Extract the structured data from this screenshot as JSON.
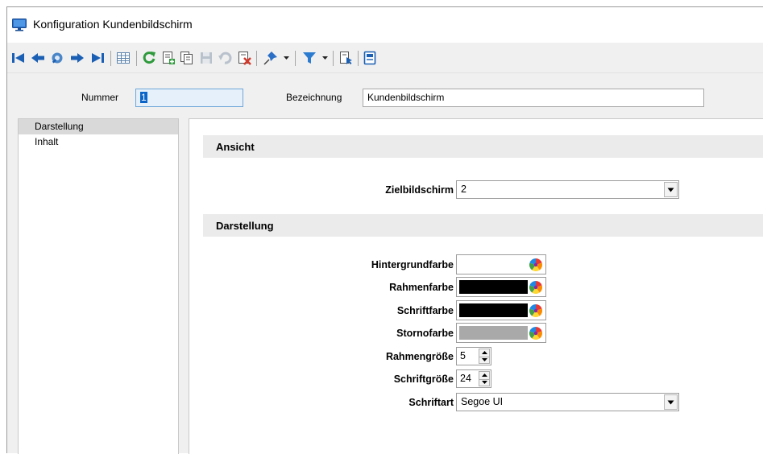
{
  "window": {
    "title": "Konfiguration Kundenbildschirm",
    "app_icon": "monitor-icon"
  },
  "toolbar": {
    "buttons": [
      {
        "name": "first-record-button",
        "icon": "first-icon"
      },
      {
        "name": "previous-record-button",
        "icon": "previous-icon"
      },
      {
        "name": "search-record-button",
        "icon": "search-icon"
      },
      {
        "name": "next-record-button",
        "icon": "next-icon"
      },
      {
        "name": "last-record-button",
        "icon": "last-icon"
      },
      {
        "name": "table-view-button",
        "icon": "table-icon"
      },
      {
        "name": "refresh-button",
        "icon": "refresh-icon"
      },
      {
        "name": "new-record-button",
        "icon": "new-icon"
      },
      {
        "name": "copy-record-button",
        "icon": "copy-icon"
      },
      {
        "name": "save-button",
        "icon": "save-icon"
      },
      {
        "name": "undo-button",
        "icon": "undo-icon"
      },
      {
        "name": "delete-button",
        "icon": "delete-icon"
      },
      {
        "name": "pin-button",
        "icon": "pin-icon"
      },
      {
        "name": "filter-button",
        "icon": "filter-icon"
      },
      {
        "name": "export-button",
        "icon": "export-icon"
      },
      {
        "name": "form-button",
        "icon": "form-icon"
      }
    ],
    "colors": {
      "blue": "#1a5fb4",
      "green": "#2e9a3c",
      "red": "#d03a2c"
    }
  },
  "header": {
    "nummer_label": "Nummer",
    "nummer_value": "1",
    "bezeichnung_label": "Bezeichnung",
    "bezeichnung_value": "Kundenbildschirm"
  },
  "nav": {
    "items": [
      {
        "label": "Darstellung",
        "selected": true
      },
      {
        "label": "Inhalt",
        "selected": false
      }
    ]
  },
  "panel": {
    "ansicht": {
      "title": "Ansicht",
      "zielbildschirm_label": "Zielbildschirm",
      "zielbildschirm_value": "2"
    },
    "darstellung": {
      "title": "Darstellung",
      "colors": [
        {
          "label": "Hintergrundfarbe",
          "color": "#ffffff"
        },
        {
          "label": "Rahmenfarbe",
          "color": "#000000"
        },
        {
          "label": "Schriftfarbe",
          "color": "#000000"
        },
        {
          "label": "Stornofarbe",
          "color": "#a9a9a9"
        }
      ],
      "rahmengroesse_label": "Rahmengröße",
      "rahmengroesse_value": "5",
      "schriftgroesse_label": "Schriftgröße",
      "schriftgroesse_value": "24",
      "schriftart_label": "Schriftart",
      "schriftart_value": "Segoe UI"
    }
  }
}
